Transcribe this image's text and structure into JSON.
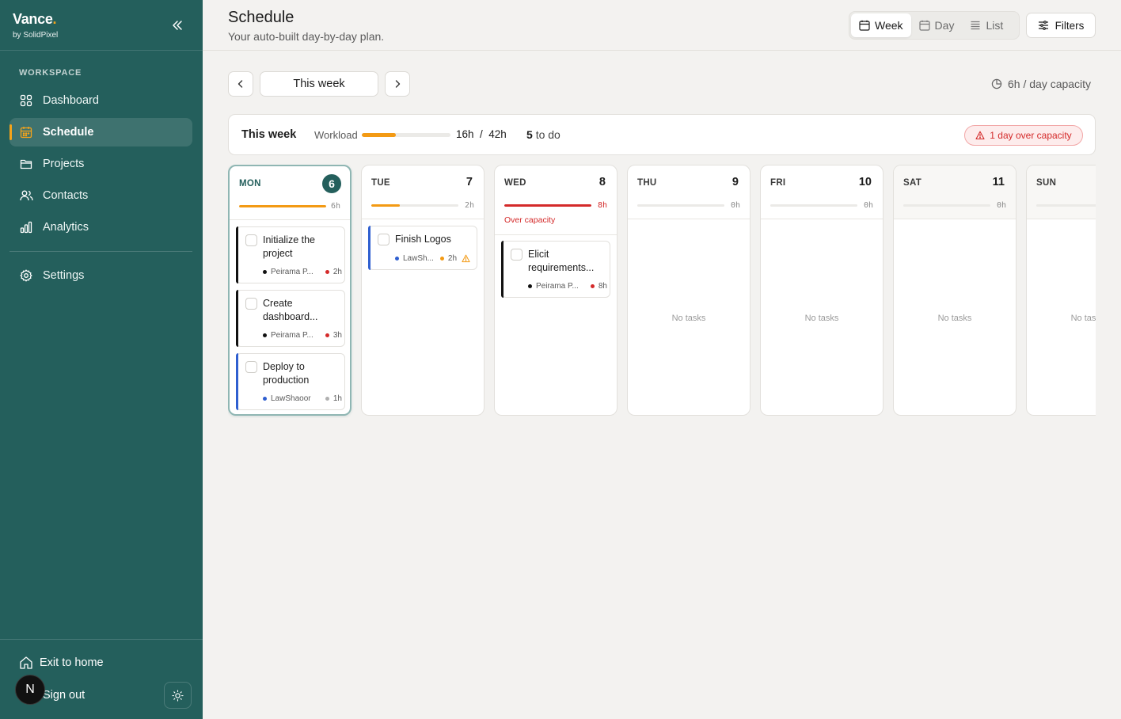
{
  "brand": {
    "name": "Vance",
    "dot": ".",
    "sub": "by SolidPixel"
  },
  "sidebar": {
    "section_label": "WORKSPACE",
    "items": [
      {
        "label": "Dashboard",
        "icon": "grid-icon"
      },
      {
        "label": "Schedule",
        "icon": "calendar-icon",
        "active": true
      },
      {
        "label": "Projects",
        "icon": "folder-icon"
      },
      {
        "label": "Contacts",
        "icon": "users-icon"
      },
      {
        "label": "Analytics",
        "icon": "bar-chart-icon"
      }
    ],
    "settings": "Settings",
    "exit": "Exit to home",
    "signout": "Sign out",
    "avatar_letter": "N"
  },
  "header": {
    "title": "Schedule",
    "subtitle": "Your auto-built day-by-day plan.",
    "views": [
      "Week",
      "Day",
      "List"
    ],
    "active_view": "Week",
    "filters": "Filters"
  },
  "week_nav": {
    "label": "This week",
    "capacity": "6h / day capacity"
  },
  "summary": {
    "title": "This week",
    "workload_label": "Workload",
    "workload_fraction": 0.38,
    "hours": "16h  /  42h",
    "todo_count": "5",
    "todo_label": "to do",
    "over_badge": "1 day over capacity"
  },
  "days": [
    {
      "name": "MON",
      "num": "6",
      "hours": "6h",
      "load": 1.0,
      "bar_color": "#f39a14"
    },
    {
      "name": "TUE",
      "num": "7",
      "hours": "2h",
      "load": 0.33,
      "bar_color": "#f39a14"
    },
    {
      "name": "WED",
      "num": "8",
      "hours": "8h",
      "load": 1.0,
      "bar_color": "#d42a2a",
      "over_note": "Over capacity"
    },
    {
      "name": "THU",
      "num": "9",
      "hours": "0h",
      "load": 0,
      "empty": "No tasks"
    },
    {
      "name": "FRI",
      "num": "10",
      "hours": "0h",
      "load": 0,
      "empty": "No tasks"
    },
    {
      "name": "SAT",
      "num": "11",
      "hours": "0h",
      "load": 0,
      "empty": "No tasks"
    },
    {
      "name": "SUN",
      "num": "",
      "hours": "",
      "load": 0,
      "empty": "No tasks"
    }
  ],
  "tasks": {
    "mon": [
      {
        "title": "Initialize the project",
        "project": "Peirama P...",
        "duration": "2h",
        "accent": "#111111",
        "proj_dot": "#111111",
        "dur_dot": "#d42a2a"
      },
      {
        "title": "Create dashboard...",
        "project": "Peirama P...",
        "duration": "3h",
        "accent": "#111111",
        "proj_dot": "#111111",
        "dur_dot": "#d42a2a"
      },
      {
        "title": "Deploy to production",
        "project": "LawShaoor",
        "duration": "1h",
        "accent": "#2f5fd0",
        "proj_dot": "#2f5fd0",
        "dur_dot": "#b0b0b0"
      }
    ],
    "tue": [
      {
        "title": "Finish Logos",
        "project": "LawSh...",
        "duration": "2h",
        "accent": "#2f5fd0",
        "proj_dot": "#2f5fd0",
        "dur_dot": "#f39a14",
        "warning": true
      }
    ],
    "wed": [
      {
        "title": "Elicit requirements...",
        "project": "Peirama P...",
        "duration": "8h",
        "accent": "#111111",
        "proj_dot": "#111111",
        "dur_dot": "#d42a2a"
      }
    ]
  }
}
